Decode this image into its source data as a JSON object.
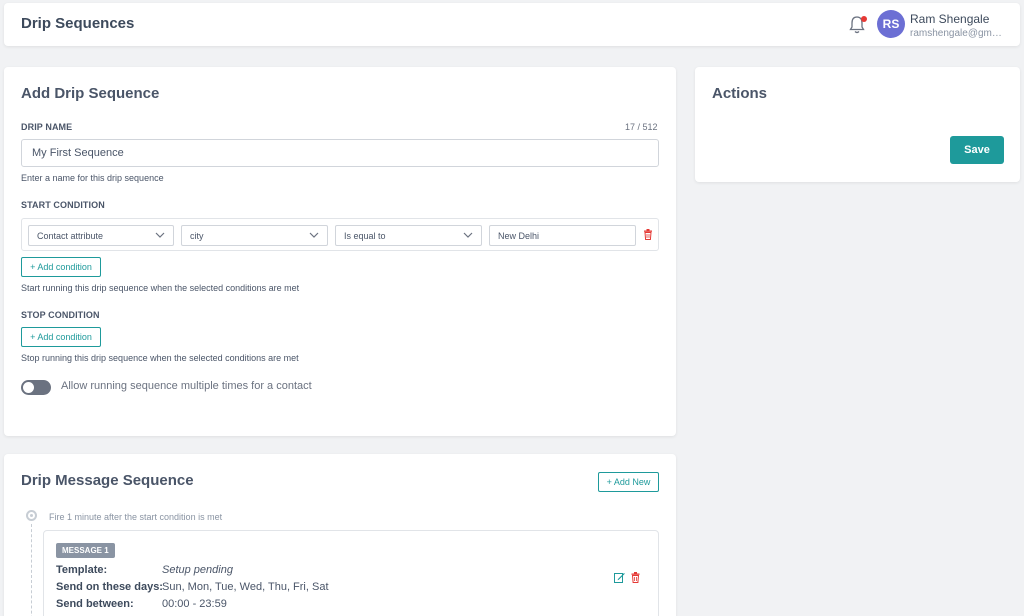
{
  "header": {
    "title": "Drip Sequences",
    "user": {
      "initials": "RS",
      "name": "Ram Shengale",
      "email": "ramshengale@gma..."
    }
  },
  "add_card": {
    "title": "Add Drip Sequence",
    "drip_name": {
      "label": "DRIP NAME",
      "counter": "17 / 512",
      "value": "My First Sequence",
      "hint": "Enter a name for this drip sequence"
    },
    "start_condition": {
      "label": "START CONDITION",
      "row": {
        "attribute_type": "Contact attribute",
        "attribute": "city",
        "operator": "Is equal to",
        "value": "New Delhi"
      },
      "add_label": "+ Add condition",
      "hint": "Start running this drip sequence when the selected conditions are met"
    },
    "stop_condition": {
      "label": "STOP CONDITION",
      "add_label": "+ Add condition",
      "hint": "Stop running this drip sequence when the selected conditions are met"
    },
    "toggle": {
      "label": "Allow running sequence multiple times for a contact",
      "on": false
    }
  },
  "actions_card": {
    "title": "Actions",
    "save_label": "Save"
  },
  "drip_card": {
    "title": "Drip Message Sequence",
    "add_new_label": "+ Add New",
    "fire_text": "Fire 1 minute after the start condition is met",
    "message": {
      "badge": "MESSAGE 1",
      "template_key": "Template:",
      "template_val": "Setup pending",
      "days_key": "Send on these days:",
      "days_val": "Sun, Mon, Tue, Wed, Thu, Fri, Sat",
      "between_key": "Send between:",
      "between_val": "00:00 - 23:59"
    }
  },
  "colors": {
    "accent": "#1e9a9b",
    "avatar": "#6c6fd4",
    "danger": "#e53935"
  }
}
